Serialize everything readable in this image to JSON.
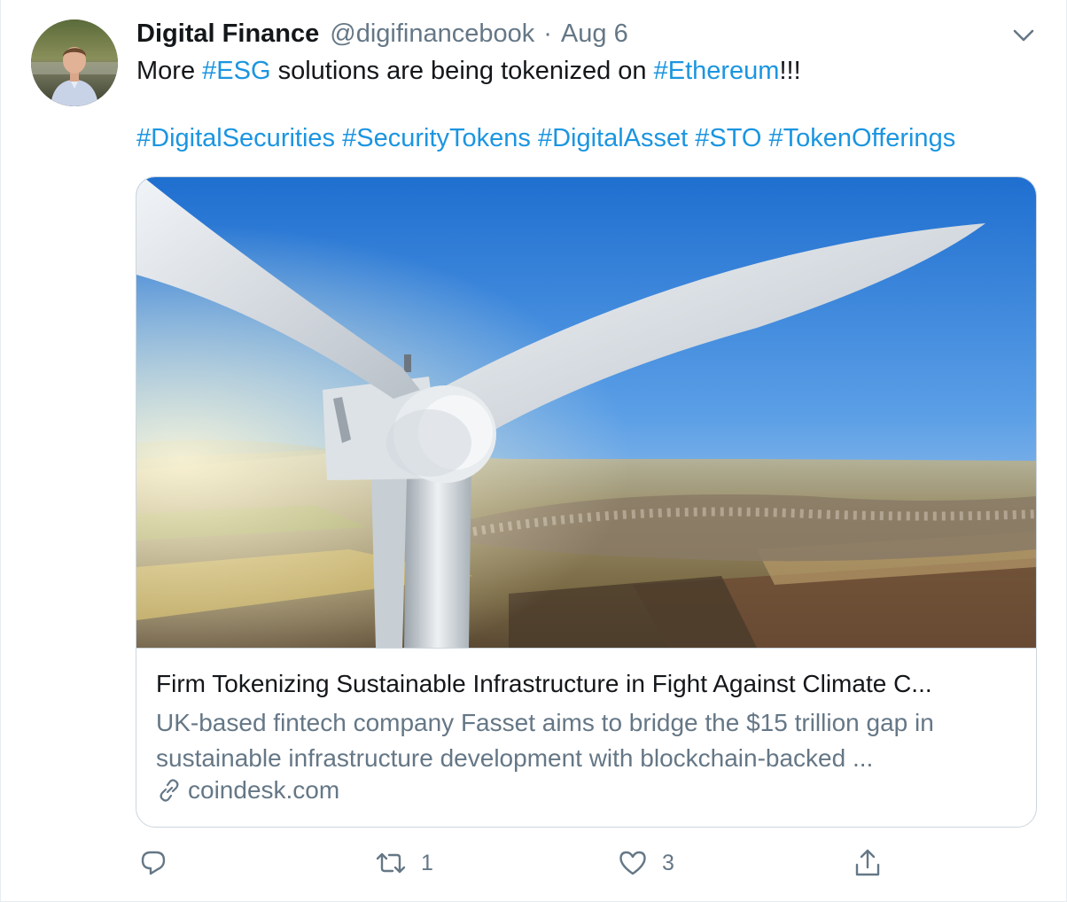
{
  "author": {
    "display_name": "Digital Finance",
    "handle": "@digifinancebook",
    "separator": "·",
    "date": "Aug 6"
  },
  "tweet": {
    "line1": {
      "prefix": "More ",
      "tag1": "#ESG",
      "middle": " solutions are being tokenized on ",
      "tag2": "#Ethereum",
      "suffix": "!!!"
    },
    "hashtags": [
      "#DigitalSecurities",
      "#SecurityTokens",
      "#DigitalAsset",
      "#STO",
      "#TokenOfferings"
    ]
  },
  "card": {
    "title": "Firm Tokenizing Sustainable Infrastructure in Fight Against Climate C...",
    "description_line1": "UK-based fintech company Fasset aims to bridge the $15 trillion gap in",
    "description_line2": "sustainable infrastructure development with blockchain-backed ...",
    "domain": "coindesk.com"
  },
  "actions": {
    "reply_count": "",
    "retweet_count": "1",
    "like_count": "3"
  },
  "colors": {
    "accent": "#1b95e0",
    "secondary_text": "#657786",
    "border": "#ccd6dd"
  },
  "icons": [
    "chevron-down-icon",
    "link-icon",
    "reply-icon",
    "retweet-icon",
    "like-icon",
    "share-icon"
  ]
}
